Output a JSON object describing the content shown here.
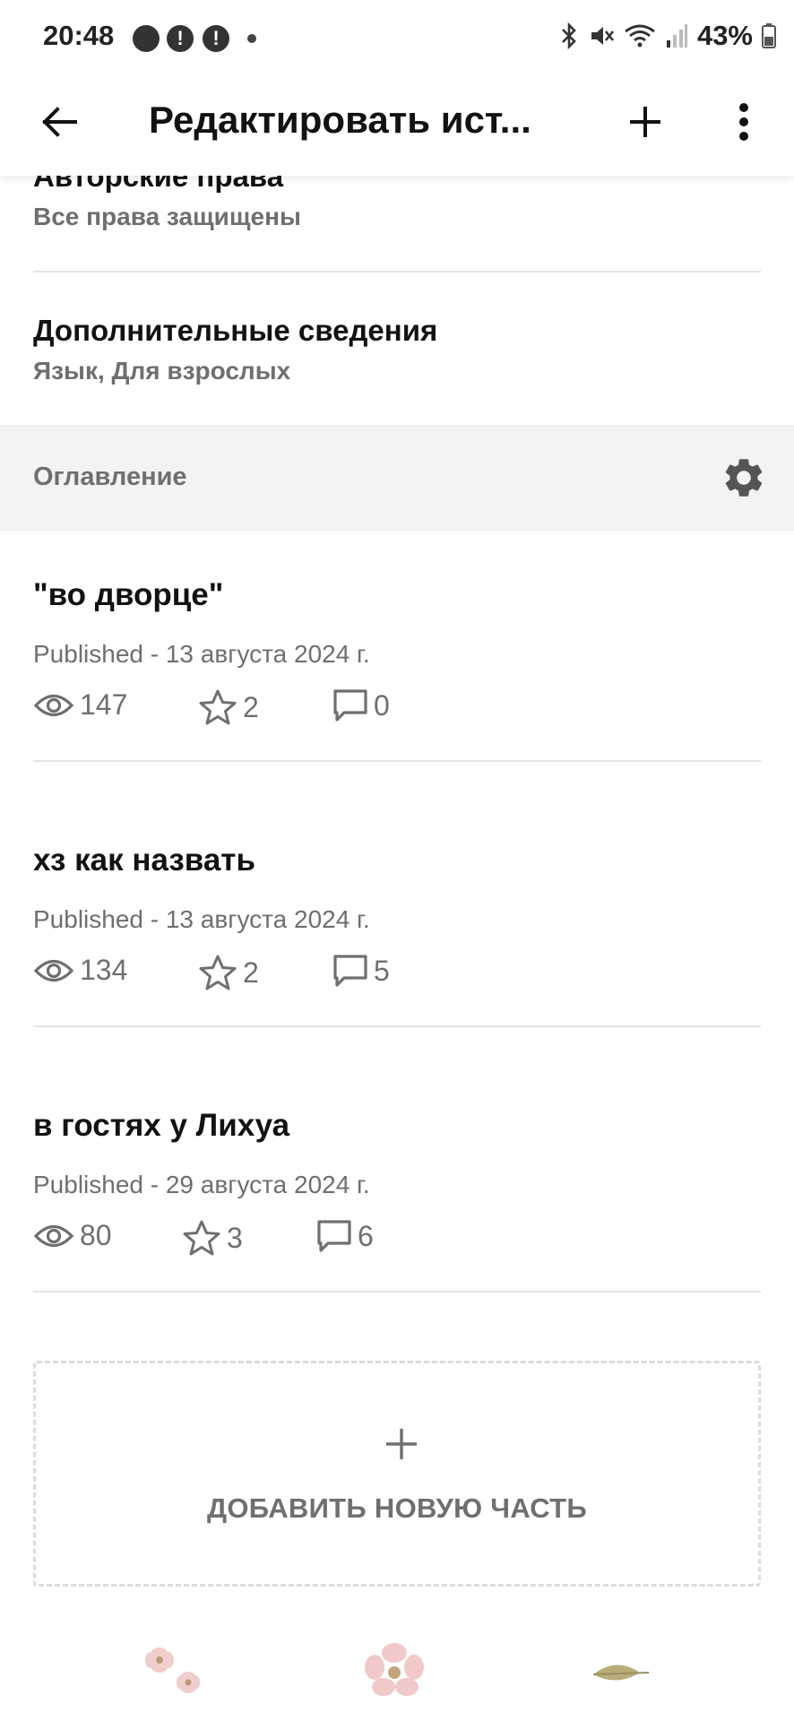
{
  "status_bar": {
    "time": "20:48",
    "notif_icons": [
      "messenger-icon",
      "alert-icon",
      "alert-icon"
    ],
    "battery_text": "43%"
  },
  "app_bar": {
    "title": "Редактировать ист..."
  },
  "details": [
    {
      "title": "Авторские права",
      "subtitle": "Все права защищены"
    },
    {
      "title": "Дополнительные сведения",
      "subtitle": "Язык, Для взрослых"
    }
  ],
  "toc": {
    "label": "Оглавление"
  },
  "parts": [
    {
      "title": "\"во дворце\"",
      "meta": "Published - 13 августа 2024 г.",
      "views": "147",
      "votes": "2",
      "comments": "0"
    },
    {
      "title": "хз как назвать",
      "meta": "Published - 13 августа 2024 г.",
      "views": "134",
      "votes": "2",
      "comments": "5"
    },
    {
      "title": "в гостях у Лихуа",
      "meta": "Published - 29 августа 2024 г.",
      "views": "80",
      "votes": "3",
      "comments": "6"
    }
  ],
  "add_part": {
    "label": "ДОБАВИТЬ НОВУЮ ЧАСТЬ"
  },
  "colors": {
    "text_primary": "#121212",
    "text_secondary": "#6f6f6f",
    "toc_background": "#f3f3f6",
    "divider": "#e4e4e4"
  }
}
